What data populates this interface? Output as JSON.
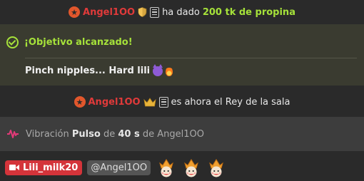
{
  "tip_event": {
    "username": "Angel1OO",
    "action": "ha dado",
    "amount": "200 tk de propina"
  },
  "goal": {
    "heading": "¡Objetivo alcanzado!",
    "description": "Pinch nipples... Hard lili"
  },
  "king_event": {
    "username": "Angel1OO",
    "text": "es ahora el Rey de la sala"
  },
  "vibration": {
    "label": "Vibración",
    "pattern": "Pulso",
    "word_de": "de",
    "duration": "40 s",
    "word_de2": "de",
    "username": "Angel1OO"
  },
  "chat_message": {
    "sender": "Lili_milk20",
    "mention": "@Angel1OO"
  },
  "colors": {
    "username_red": "#e03a3a",
    "goal_green": "#a6e23a",
    "sender_chip": "#d4343a",
    "background": "#2a2a2a"
  },
  "icons": [
    "star-badge-icon",
    "shield-icon",
    "document-icon",
    "goal-check-icon",
    "devil-emoji-icon",
    "fire-emoji-icon",
    "crown-icon",
    "vibration-wave-icon",
    "camera-icon",
    "king-emoji-icon"
  ]
}
